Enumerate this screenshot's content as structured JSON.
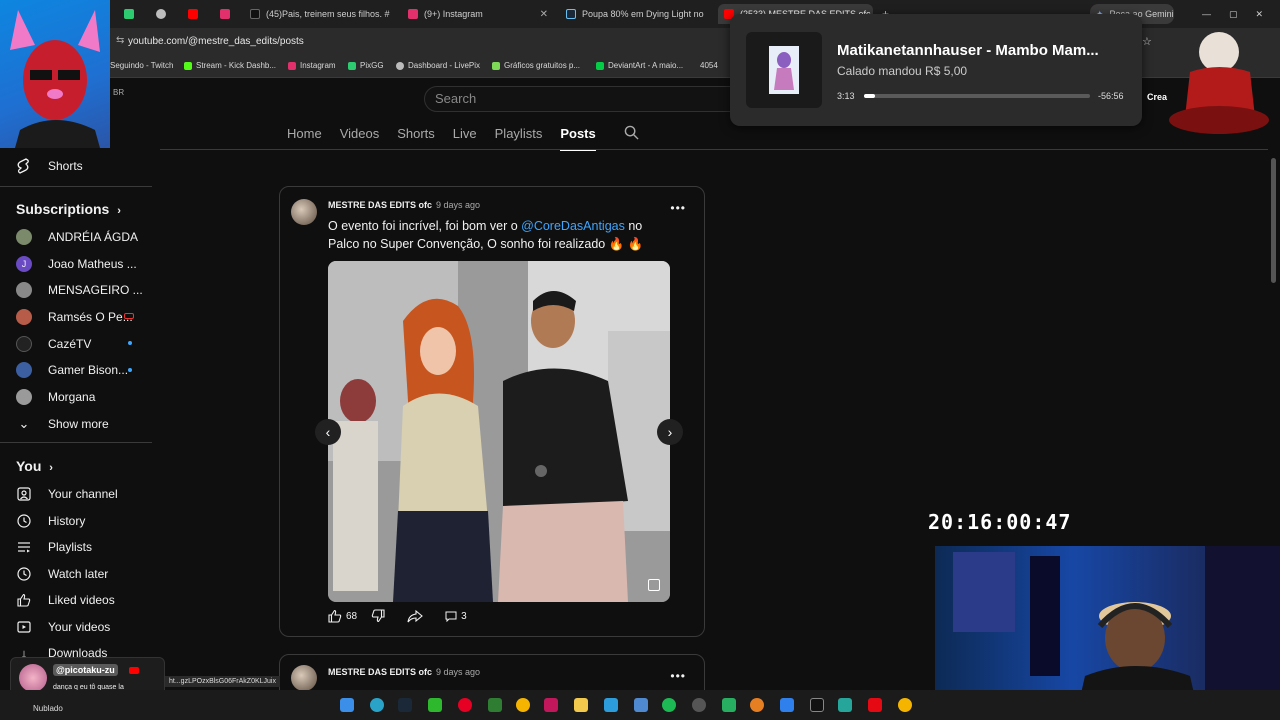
{
  "browser": {
    "tabs": [
      {
        "label": "",
        "color": "#2ecc71"
      },
      {
        "label": "",
        "color": "#bdbdbd"
      },
      {
        "label": "",
        "color": "#ff0000"
      },
      {
        "label": "",
        "color": "#e1306c"
      },
      {
        "label": "(45)Pais, treinem seus filhos. #",
        "color": "#111111"
      },
      {
        "label": "(9+) Instagram",
        "color": "#e1306c"
      },
      {
        "label": "Poupa 80% em Dying Light no",
        "color": "#1b2838"
      },
      {
        "label": "(2533) MESTRE DAS EDITS ofc",
        "color": "#ff0000"
      }
    ],
    "gemini_label": "Peça ao Gemini",
    "url": "youtube.com/@mestre_das_edits/posts",
    "bookmarks": [
      "Seguindo - Twitch",
      "Stream - Kick Dashb...",
      "Instagram",
      "PixGG",
      "Dashboard - LivePix",
      "Gráficos gratuitos p...",
      "DeviantArt - A maio...",
      "4054"
    ]
  },
  "youtube": {
    "country": "BR",
    "search_placeholder": "Search",
    "channel_tabs": [
      "Home",
      "Videos",
      "Shorts",
      "Live",
      "Playlists",
      "Posts"
    ],
    "active_tab": "Posts"
  },
  "sidebar": {
    "shorts": "Shorts",
    "subscriptions_title": "Subscriptions",
    "subscriptions": [
      {
        "name": "ANDRÉIA ÁGDA",
        "color": "#7a8a6a"
      },
      {
        "name": "Joao Matheus ...",
        "color": "#6a4bc4"
      },
      {
        "name": "MENSAGEIRO ...",
        "color": "#888888"
      },
      {
        "name": "Ramsés O Pe...",
        "color": "#b85c4a"
      },
      {
        "name": "CazéTV",
        "color": "#222222"
      },
      {
        "name": "Gamer Bison...",
        "color": "#3b5fa0"
      },
      {
        "name": "Morgana",
        "color": "#9a9a9a"
      }
    ],
    "show_more": "Show more",
    "you_title": "You",
    "you_items": [
      "Your channel",
      "History",
      "Playlists",
      "Watch later",
      "Liked videos",
      "Your videos",
      "Downloads"
    ]
  },
  "post": {
    "author": "MESTRE DAS EDITS ofc",
    "time": "9 days ago",
    "text_before": "O evento foi incrível, foi bom ver o ",
    "mention": "@CoreDasAntigas",
    "text_after": " no Palco no Super Convenção, O sonho foi realizado 🔥 🔥",
    "likes": "68",
    "comments": "3"
  },
  "post2": {
    "author": "MESTRE DAS EDITS ofc",
    "time": "9 days ago"
  },
  "media": {
    "title": "Matikanetannhauser - Mambo Mam...",
    "subtitle": "Calado mandou R$ 5,00",
    "elapsed": "3:13",
    "remaining": "-56:56",
    "progress": 0.05,
    "crea_label": "Crea"
  },
  "overlay": {
    "clock": "20:16:00:47"
  },
  "chat": {
    "user": "@picotaku-zu",
    "message": "dança q eu tô quase la"
  },
  "status_url": "ht...gzLPOzxBlsG06FrAkZ0KLJuix",
  "taskbar": {
    "weather": "Nublado"
  }
}
